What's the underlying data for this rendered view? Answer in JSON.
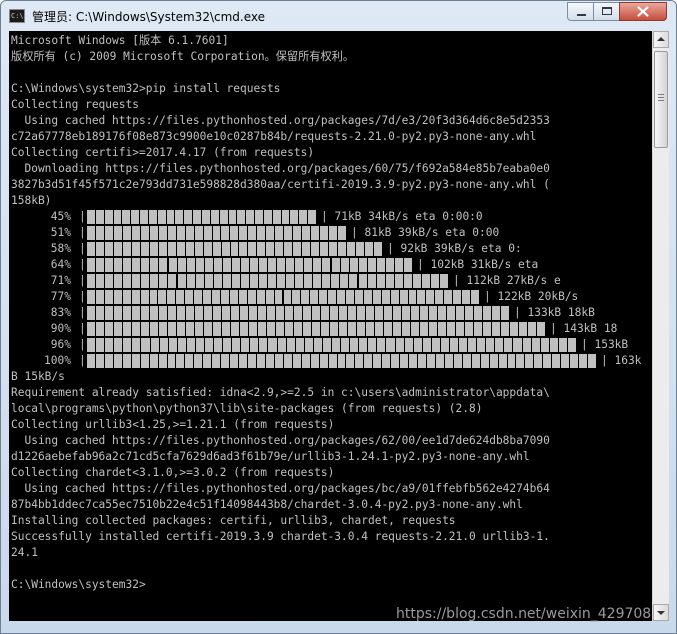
{
  "window": {
    "title": "管理员: C:\\Windows\\System32\\cmd.exe",
    "icon": "cmd-icon",
    "controls": [
      "minimize",
      "maximize",
      "close"
    ]
  },
  "console": {
    "lines": [
      {
        "text": "Microsoft Windows [版本 6.1.7601]"
      },
      {
        "text": "版权所有 (c) 2009 Microsoft Corporation。保留所有权利。"
      },
      {
        "text": ""
      },
      {
        "text": "C:\\Windows\\system32>pip install requests"
      },
      {
        "text": "Collecting requests"
      },
      {
        "text": "  Using cached https://files.pythonhosted.org/packages/7d/e3/20f3d364d6c8e5d2353"
      },
      {
        "text": "c72a67778eb189176f08e873c9900e10c0287b84b/requests-2.21.0-py2.py3-none-any.whl"
      },
      {
        "text": "Collecting certifi>=2017.4.17 (from requests)"
      },
      {
        "text": "  Downloading https://files.pythonhosted.org/packages/60/75/f692a584e85b7eaba0e0"
      },
      {
        "text": "3827b3d51f45f571c2e793dd731e598828d380aa/certifi-2019.3.9-py2.py3-none-any.whl ("
      },
      {
        "text": "158kB)"
      },
      {
        "progress": true,
        "percent": "45%",
        "fraction": 0.45,
        "status": "| 71kB 34kB/s eta 0:00:0"
      },
      {
        "progress": true,
        "percent": "51%",
        "fraction": 0.51,
        "status": "| 81kB 39kB/s eta 0:00"
      },
      {
        "progress": true,
        "percent": "58%",
        "fraction": 0.58,
        "status": "| 92kB 39kB/s eta 0:"
      },
      {
        "progress": true,
        "percent": "64%",
        "fraction": 0.64,
        "status": "| 102kB 31kB/s eta"
      },
      {
        "progress": true,
        "percent": "71%",
        "fraction": 0.71,
        "status": "| 112kB 27kB/s e"
      },
      {
        "progress": true,
        "percent": "77%",
        "fraction": 0.77,
        "status": "| 122kB 20kB/s"
      },
      {
        "progress": true,
        "percent": "83%",
        "fraction": 0.83,
        "status": "| 133kB 18kB"
      },
      {
        "progress": true,
        "percent": "90%",
        "fraction": 0.9,
        "status": "| 143kB 18"
      },
      {
        "progress": true,
        "percent": "96%",
        "fraction": 0.96,
        "status": "| 153kB"
      },
      {
        "progress": true,
        "percent": "100%",
        "fraction": 1.0,
        "status": "| 163k"
      },
      {
        "text": "B 15kB/s"
      },
      {
        "text": "Requirement already satisfied: idna<2.9,>=2.5 in c:\\users\\administrator\\appdata\\"
      },
      {
        "text": "local\\programs\\python\\python37\\lib\\site-packages (from requests) (2.8)"
      },
      {
        "text": "Collecting urllib3<1.25,>=1.21.1 (from requests)"
      },
      {
        "text": "  Using cached https://files.pythonhosted.org/packages/62/00/ee1d7de624db8ba7090"
      },
      {
        "text": "d1226aebefab96a2c71cd5cfa7629d6ad3f61b79e/urllib3-1.24.1-py2.py3-none-any.whl"
      },
      {
        "text": "Collecting chardet<3.1.0,>=3.0.2 (from requests)"
      },
      {
        "text": "  Using cached https://files.pythonhosted.org/packages/bc/a9/01ffebfb562e4274b64"
      },
      {
        "text": "87b4bb1ddec7ca55ec7510b22e4c51f14098443b8/chardet-3.0.4-py2.py3-none-any.whl"
      },
      {
        "text": "Installing collected packages: certifi, urllib3, chardet, requests"
      },
      {
        "text": "Successfully installed certifi-2019.3.9 chardet-3.0.4 requests-2.21.0 urllib3-1."
      },
      {
        "text": "24.1"
      },
      {
        "text": ""
      },
      {
        "text": "C:\\Windows\\system32>"
      }
    ]
  },
  "watermark": "https://blog.csdn.net/weixin_429708",
  "colors": {
    "console_bg": "#000000",
    "console_fg": "#c0c0c0",
    "titlebar": "#dfe9f5",
    "close_button": "#c74d3b"
  }
}
